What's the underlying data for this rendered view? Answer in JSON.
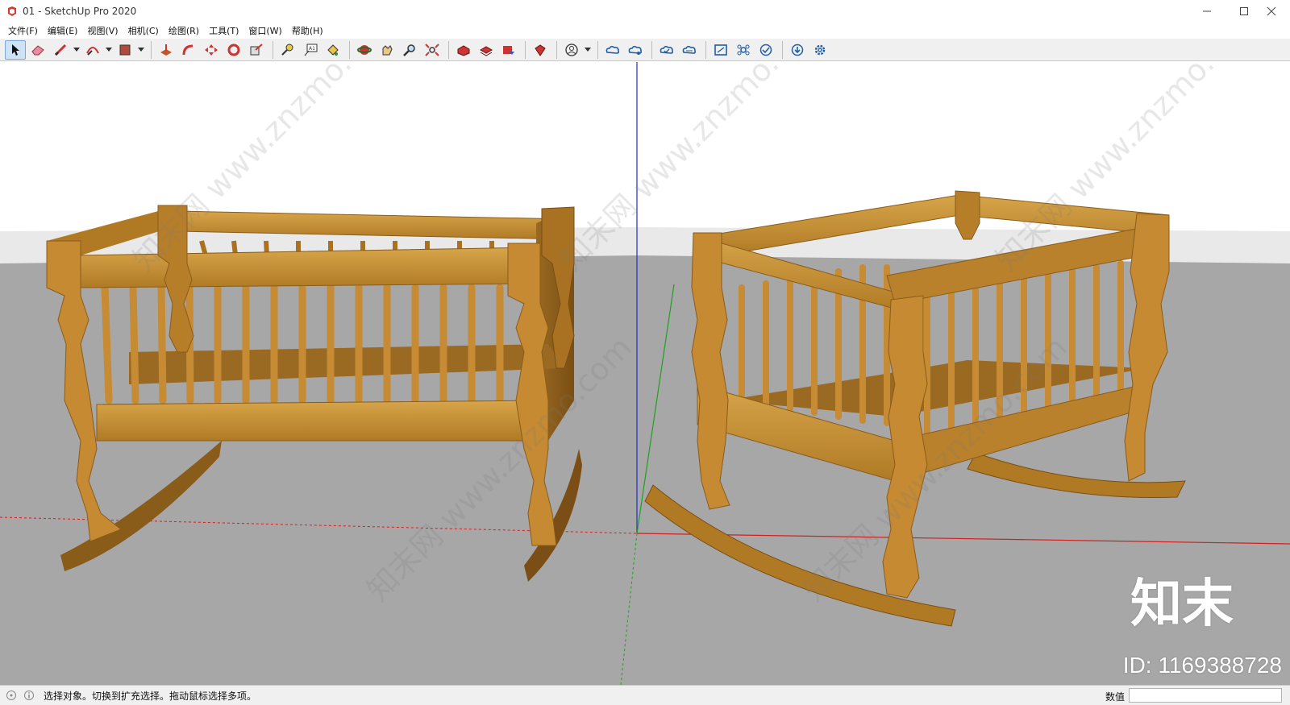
{
  "window": {
    "title": "01 - SketchUp Pro 2020",
    "controls": [
      "minimize-icon",
      "maximize-icon",
      "close-icon"
    ]
  },
  "menu": {
    "items": [
      "文件(F)",
      "编辑(E)",
      "视图(V)",
      "相机(C)",
      "绘图(R)",
      "工具(T)",
      "窗口(W)",
      "帮助(H)"
    ]
  },
  "toolbar": {
    "tools": [
      "select-tool-icon",
      "eraser-tool-icon",
      "pencil-tool-icon",
      "arc-tool-icon",
      "rectangle-tool-icon",
      "push-pull-tool-icon",
      "follow-me-tool-icon",
      "move-tool-icon",
      "rotate-tool-icon",
      "scale-tool-icon",
      "tape-measure-tool-icon",
      "text-tool-icon",
      "paint-bucket-tool-icon",
      "orbit-tool-icon",
      "pan-tool-icon",
      "zoom-tool-icon",
      "zoom-extents-tool-icon",
      "warehouse-icon",
      "extension-warehouse-icon",
      "send-to-layout-icon",
      "extension-manager-icon",
      "account-icon",
      "trimble-connect-icon",
      "collaborate-icon",
      "cloud-open-icon",
      "cloud-share-icon",
      "model-info-icon",
      "components-icon",
      "check-icon",
      "download-icon",
      "settings-icon"
    ]
  },
  "viewport": {
    "watermark": "知末网 www.znzmo.com",
    "brand": "知末",
    "id_label": "ID: 1169388728"
  },
  "status": {
    "text": "选择对象。切换到扩充选择。拖动鼠标选择多项。",
    "measurements_label": "数值",
    "measurements_value": ""
  },
  "colors": {
    "sky": "#ffffff",
    "ground": "#a9a9a9",
    "wood": "#c8922f",
    "wood_dark": "#8a5c1a",
    "axis_red": "#d02020",
    "axis_green": "#20a020",
    "axis_blue": "#2030c0"
  }
}
